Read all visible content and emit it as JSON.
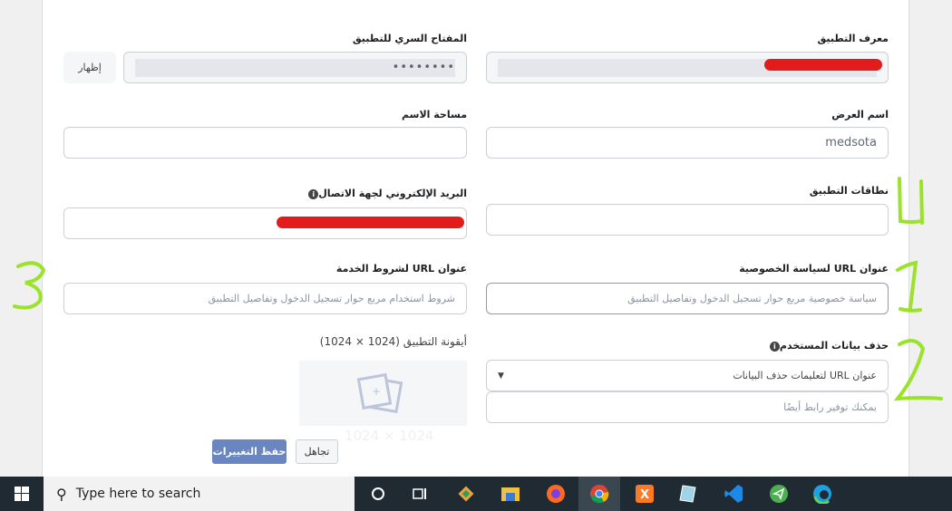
{
  "form": {
    "app_id": {
      "label": "معرف التطبيق",
      "value": ""
    },
    "app_secret": {
      "label": "المفتاح السري للتطبيق",
      "value": "••••••••",
      "show_button": "إظهار"
    },
    "display_name": {
      "label": "اسم العرض",
      "value": "medsota"
    },
    "namespace": {
      "label": "مساحة الاسم",
      "value": ""
    },
    "app_domains": {
      "label": "نطاقات التطبيق",
      "value": ""
    },
    "contact_email": {
      "label": "البريد الإلكتروني لجهة الاتصال",
      "value": ""
    },
    "privacy_url": {
      "label": "عنوان URL لسياسة الخصوصية",
      "placeholder": "سياسة خصوصية مربع حوار تسجيل الدخول وتفاصيل التطبيق"
    },
    "tos_url": {
      "label": "عنوان URL لشروط الخدمة",
      "placeholder": "شروط استخدام مربع حوار تسجيل الدخول وتفاصيل التطبيق"
    },
    "data_deletion": {
      "label": "حذف بيانات المستخدم",
      "select_value": "عنوان URL لتعليمات حذف البيانات",
      "placeholder": "يمكنك توفير رابط أيضًا"
    },
    "app_icon": {
      "label": "أيقونة التطبيق (1024 × 1024)",
      "size_text": "1024 × 1024"
    },
    "save_label": "حفظ التغييرات",
    "discard_label": "تجاهل"
  },
  "annotations": [
    "1",
    "2",
    "3",
    "4"
  ],
  "taskbar": {
    "search_placeholder": "Type here to search",
    "apps": [
      "cortana",
      "task-view",
      "git",
      "file-explorer",
      "firefox",
      "chrome",
      "xampp",
      "notepad",
      "vscode",
      "telegram",
      "edge"
    ]
  },
  "colors": {
    "primary": "#4267b2",
    "redaction": "#e21b1b",
    "annotation": "#9be22b"
  }
}
